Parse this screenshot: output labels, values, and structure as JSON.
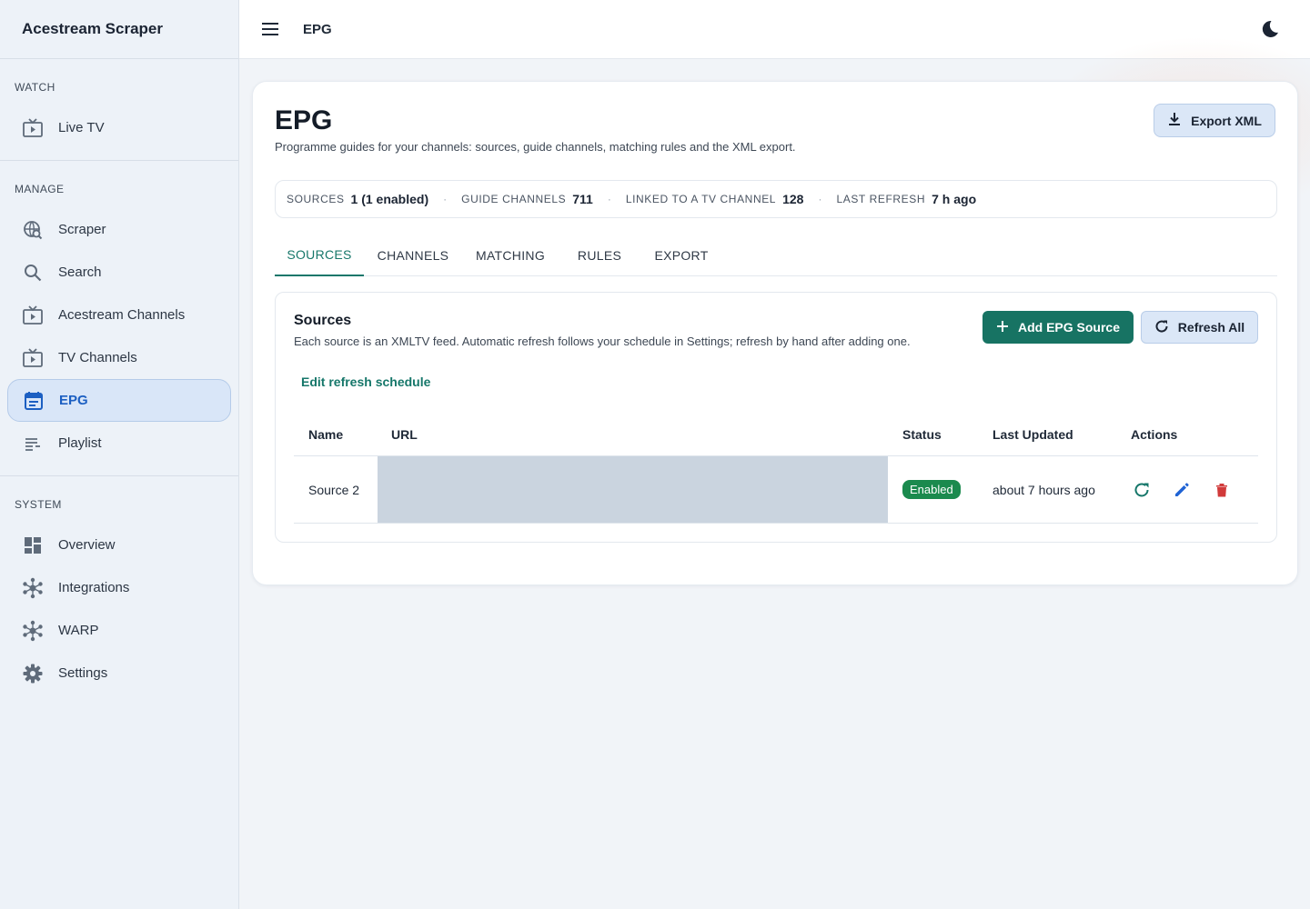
{
  "app": {
    "title": "Acestream Scraper"
  },
  "topbar": {
    "title": "EPG"
  },
  "sidebar": {
    "sections": [
      {
        "title": "WATCH",
        "items": [
          {
            "label": "Live TV",
            "icon": "tv-icon"
          }
        ]
      },
      {
        "title": "MANAGE",
        "items": [
          {
            "label": "Scraper",
            "icon": "scraper-icon"
          },
          {
            "label": "Search",
            "icon": "search-icon"
          },
          {
            "label": "Acestream Channels",
            "icon": "tv-icon"
          },
          {
            "label": "TV Channels",
            "icon": "tv-icon"
          },
          {
            "label": "EPG",
            "icon": "calendar-icon",
            "active": true
          },
          {
            "label": "Playlist",
            "icon": "playlist-icon"
          }
        ]
      },
      {
        "title": "SYSTEM",
        "items": [
          {
            "label": "Overview",
            "icon": "dashboard-icon"
          },
          {
            "label": "Integrations",
            "icon": "hub-icon"
          },
          {
            "label": "WARP",
            "icon": "hub-icon"
          },
          {
            "label": "Settings",
            "icon": "gear-icon"
          }
        ]
      }
    ]
  },
  "page": {
    "title": "EPG",
    "subtitle": "Programme guides for your channels: sources, guide channels, matching rules and the XML export.",
    "export_label": "Export XML"
  },
  "stats": [
    {
      "label": "SOURCES",
      "value": "1 (1 enabled)"
    },
    {
      "label": "GUIDE CHANNELS",
      "value": "711"
    },
    {
      "label": "LINKED TO A TV CHANNEL",
      "value": "128"
    },
    {
      "label": "LAST REFRESH",
      "value": "7 h ago"
    }
  ],
  "tabs": [
    "SOURCES",
    "CHANNELS",
    "MATCHING",
    "RULES",
    "EXPORT"
  ],
  "sources": {
    "title": "Sources",
    "subtitle": "Each source is an XMLTV feed. Automatic refresh follows your schedule in Settings; refresh by hand after adding one.",
    "add_label": "Add EPG Source",
    "refresh_label": "Refresh All",
    "edit_schedule_label": "Edit refresh schedule",
    "columns": [
      "Name",
      "URL",
      "Status",
      "Last Updated",
      "Actions"
    ],
    "rows": [
      {
        "name": "Source 2",
        "url": "",
        "status": "Enabled",
        "last_updated": "about 7 hours ago"
      }
    ]
  },
  "colors": {
    "accent": "#16776a",
    "active_nav": "#1c5fc2",
    "enabled_badge": "#1b8a4e",
    "delete": "#d13a3a",
    "edit": "#1f63d4"
  }
}
